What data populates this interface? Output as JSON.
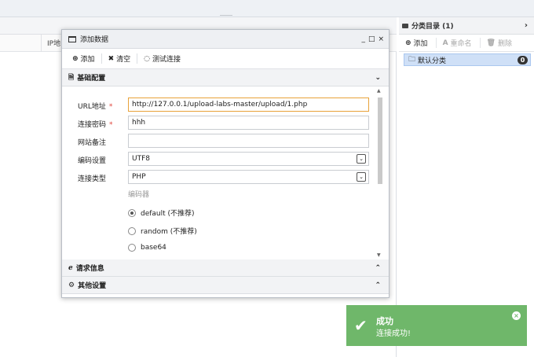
{
  "background": {
    "left_column_header": "IP地",
    "category_panel": {
      "title": "分类目录 (1)",
      "toolbar": {
        "add": "添加",
        "rename": "重命名",
        "delete": "删除"
      },
      "items": [
        {
          "label": "默认分类",
          "count": "0"
        }
      ]
    }
  },
  "dialog": {
    "title": "添加数据",
    "window_controls": {
      "minimize": "_",
      "maximize": "□",
      "close": "×"
    },
    "toolbar": {
      "add": "添加",
      "clear": "清空",
      "test": "测试连接"
    },
    "sections": {
      "basic": "基础配置",
      "request": "请求信息",
      "other": "其他设置"
    },
    "form": {
      "url_label": "URL地址",
      "url_value": "http://127.0.0.1/upload-labs-master/upload/1.php",
      "password_label": "连接密码",
      "password_value": "hhh",
      "note_label": "网站备注",
      "note_value": "",
      "encoding_label": "编码设置",
      "encoding_value": "UTF8",
      "type_label": "连接类型",
      "type_value": "PHP",
      "required_mark": "*",
      "encoder_label": "编码器",
      "encoders": [
        {
          "label": "default (不推荐)",
          "selected": true
        },
        {
          "label": "random (不推荐)",
          "selected": false
        },
        {
          "label": "base64",
          "selected": false
        }
      ]
    }
  },
  "toast": {
    "title": "成功",
    "message": "连接成功!",
    "color": "#6fb76a"
  },
  "icons": [
    "window-icon",
    "plus-icon",
    "close-icon",
    "refresh-icon",
    "list-icon",
    "ie-icon",
    "gear-icon",
    "check-icon",
    "folder-icon",
    "chevron-down-icon",
    "chevron-up-icon"
  ]
}
